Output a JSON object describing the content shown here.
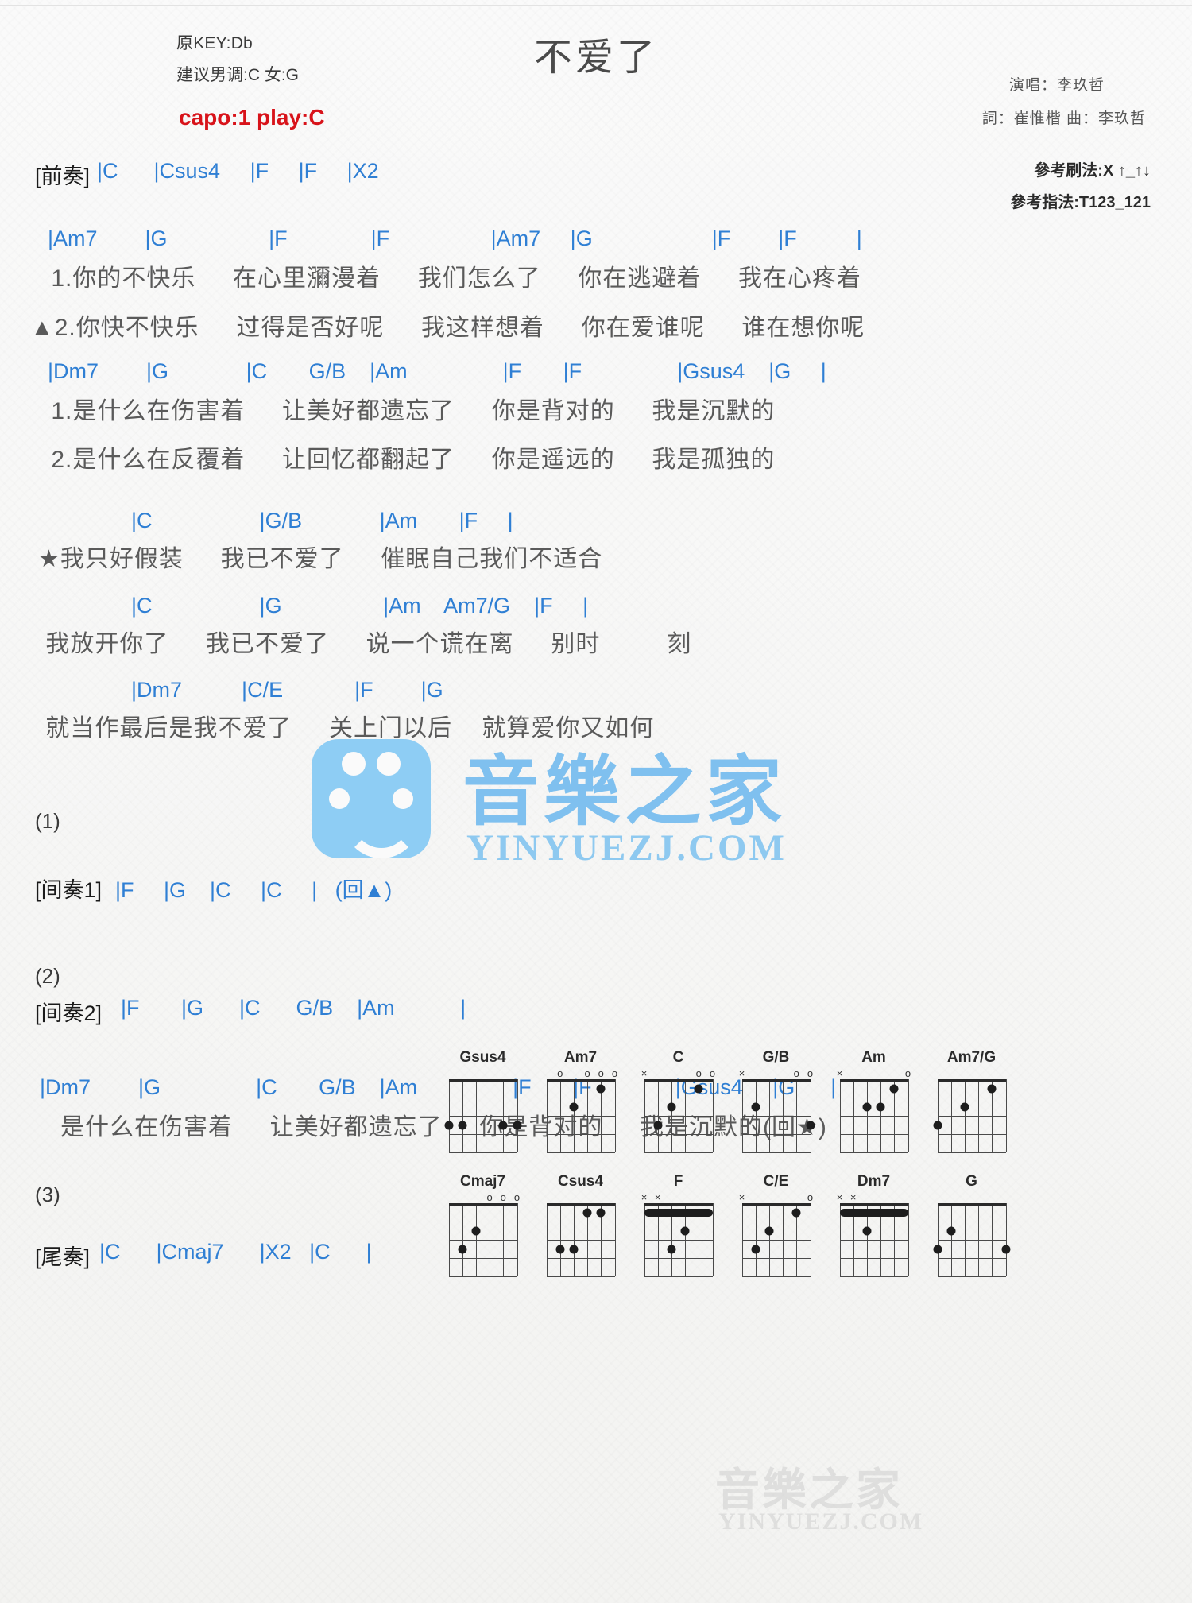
{
  "header": {
    "orig_key": "原KEY:Db",
    "suggest": "建议男调:C 女:G",
    "capo": "capo:1 play:C",
    "title": "不爱了",
    "singer": "演唱：李玖哲",
    "writers": "詞：崔惟楷   曲：李玖哲",
    "strum_ref": "參考刷法:X ↑_↑↓",
    "fingerstyle_ref": "參考指法:T123_121"
  },
  "intro": {
    "label": "[前奏]",
    "chords": "|C      |Csus4     |F     |F     |X2"
  },
  "verse1": {
    "chords_line1": "|Am7        |G                 |F              |F                 |Am7     |G                    |F        |F          |",
    "lyric_line1": " 1.你的不快乐     在心里瀰漫着     我们怎么了     你在逃避着     我在心疼着",
    "lyric_line2": "▲2.你快不快乐     过得是否好呢     我这样想着     你在爱谁呢     谁在想你呢",
    "chords_line2": "|Dm7        |G             |C       G/B    |Am                |F       |F                |Gsus4    |G     |",
    "lyric_line3": " 1.是什么在伤害着     让美好都遗忘了     你是背对的     我是沉默的",
    "lyric_line4": " 2.是什么在反覆着     让回忆都翻起了     你是遥远的     我是孤独的"
  },
  "chorus": {
    "chords_line1": "              |C                  |G/B             |Am       |F     |",
    "lyric_line1": "★我只好假装     我已不爱了     催眠自己我们不适合",
    "chords_line2": "              |C                  |G                 |Am    Am7/G    |F     |",
    "lyric_line2": " 我放开你了     我已不爱了     说一个谎在离     别时         刻",
    "chords_line3": "              |Dm7          |C/E            |F        |G",
    "lyric_line3": " 就当作最后是我不爱了     关上门以后    就算爱你又如何"
  },
  "interlude1": {
    "number": "(1)",
    "label": "[间奏1]",
    "chords": "|F     |G    |C     |C     |   (回▲)"
  },
  "interlude2": {
    "number": "(2)",
    "label": "[间奏2]",
    "chords": "|F       |G      |C      G/B    |Am           |"
  },
  "verse3": {
    "chords": "|Dm7        |G                |C       G/B    |Am                |F       |F              |Gsus4     |G      |",
    "lyric": "   是什么在伤害着     让美好都遗忘了     你是背对的     我是沉默的(回★)"
  },
  "outro": {
    "number": "(3)",
    "label": "[尾奏]",
    "chords": "|C      |Cmaj7      |X2   |C      |"
  },
  "watermark": {
    "text": "音樂之家",
    "url": "YINYUEZJ.COM"
  },
  "chord_diagrams": [
    {
      "name": "Gsus4",
      "marks": [
        {
          "x": 1,
          "t": ""
        },
        {
          "x": 2,
          "t": ""
        }
      ],
      "dots": [
        {
          "s": 5,
          "f": 3
        },
        {
          "s": 1,
          "f": 3
        },
        {
          "s": 2,
          "f": 3
        },
        {
          "s": 6,
          "f": 3
        }
      ]
    },
    {
      "name": "Am7",
      "marks": [
        {
          "x": 1,
          "t": "o"
        },
        {
          "x": 2,
          "t": "o"
        },
        {
          "x": 3,
          "t": "o"
        },
        {
          "x": 5,
          "t": "o"
        }
      ],
      "dots": [
        {
          "s": 4,
          "f": 2
        },
        {
          "s": 2,
          "f": 1
        }
      ]
    },
    {
      "name": "C",
      "marks": [
        {
          "x": 6,
          "t": "×"
        },
        {
          "x": 2,
          "t": "o"
        },
        {
          "x": 1,
          "t": "o"
        }
      ],
      "dots": [
        {
          "s": 5,
          "f": 3
        },
        {
          "s": 4,
          "f": 2
        },
        {
          "s": 2,
          "f": 1
        }
      ]
    },
    {
      "name": "G/B",
      "marks": [
        {
          "x": 6,
          "t": "×"
        },
        {
          "x": 1,
          "t": "o"
        },
        {
          "x": 2,
          "t": "o"
        }
      ],
      "dots": [
        {
          "s": 5,
          "f": 2
        },
        {
          "s": 1,
          "f": 3
        }
      ]
    },
    {
      "name": "Am",
      "marks": [
        {
          "x": 6,
          "t": "×"
        },
        {
          "x": 1,
          "t": "o"
        }
      ],
      "dots": [
        {
          "s": 4,
          "f": 2
        },
        {
          "s": 3,
          "f": 2
        },
        {
          "s": 2,
          "f": 1
        }
      ]
    },
    {
      "name": "Am7/G",
      "marks": [],
      "dots": [
        {
          "s": 6,
          "f": 3
        },
        {
          "s": 4,
          "f": 2
        },
        {
          "s": 2,
          "f": 1
        }
      ]
    },
    {
      "name": "Cmaj7",
      "marks": [
        {
          "x": 3,
          "t": "o"
        },
        {
          "x": 2,
          "t": "o"
        },
        {
          "x": 1,
          "t": "o"
        }
      ],
      "dots": [
        {
          "s": 5,
          "f": 3
        },
        {
          "s": 4,
          "f": 2
        }
      ]
    },
    {
      "name": "Csus4",
      "marks": [],
      "dots": [
        {
          "s": 5,
          "f": 3
        },
        {
          "s": 4,
          "f": 3
        },
        {
          "s": 2,
          "f": 1
        },
        {
          "s": 3,
          "f": 1
        }
      ]
    },
    {
      "name": "F",
      "marks": [
        {
          "x": 6,
          "t": "×"
        },
        {
          "x": 5,
          "t": "×"
        }
      ],
      "dots": [
        {
          "s": 4,
          "f": 3
        },
        {
          "s": 3,
          "f": 2
        },
        {
          "barre": true,
          "f": 1
        }
      ]
    },
    {
      "name": "C/E",
      "marks": [
        {
          "x": 6,
          "t": "×"
        },
        {
          "x": 1,
          "t": "o"
        }
      ],
      "dots": [
        {
          "s": 5,
          "f": 3
        },
        {
          "s": 4,
          "f": 2
        },
        {
          "s": 2,
          "f": 1
        }
      ]
    },
    {
      "name": "Dm7",
      "marks": [
        {
          "x": 6,
          "t": "×"
        },
        {
          "x": 5,
          "t": "×"
        }
      ],
      "dots": [
        {
          "s": 4,
          "f": 2
        },
        {
          "barre": true,
          "f": 1
        }
      ]
    },
    {
      "name": "G",
      "marks": [],
      "dots": [
        {
          "s": 6,
          "f": 3
        },
        {
          "s": 5,
          "f": 2
        },
        {
          "s": 1,
          "f": 3
        }
      ]
    }
  ]
}
